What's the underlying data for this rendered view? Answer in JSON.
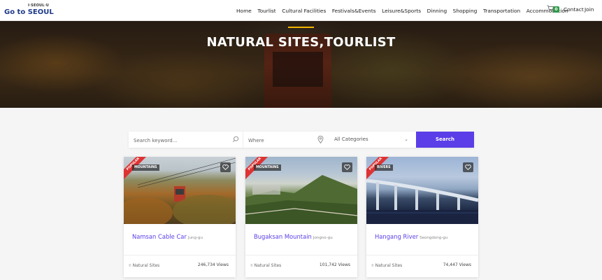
{
  "header": {
    "logo_tagline": "I·SEOUL·U",
    "logo_brand": "Go to SEOUL",
    "nav": [
      "Home",
      "Tourlist",
      "Cultural Facilities",
      "Festivals&Events",
      "Leisure&Sports",
      "Dinning",
      "Shopping",
      "Transportation",
      "Accommodation"
    ],
    "cart_count": "0",
    "contact_label": "Contact",
    "join_label": "Join"
  },
  "hero": {
    "title": "NATURAL SITES,TOURLIST"
  },
  "search": {
    "keyword_placeholder": "Search keyword...",
    "where_placeholder": "Where",
    "category_value": "All Categories",
    "button_label": "Search"
  },
  "cards": [
    {
      "badge": "POPULAR",
      "category": "MOUNTAINS",
      "title": "Namsan Cable Car",
      "district": "Jung-gu",
      "type": "Natural Sites",
      "views": "246,734 Views"
    },
    {
      "badge": "POPULAR",
      "category": "MOUNTAINS",
      "title": "Bugaksan Mountain",
      "district": "Jongno-gu",
      "type": "Natural Sites",
      "views": "101,742 Views"
    },
    {
      "badge": "POPULAR",
      "category": "RIVERS",
      "title": "Hangang River",
      "district": "Seongdong-gu",
      "type": "Natural Sites",
      "views": "74,447 Views"
    }
  ],
  "colors": {
    "accent": "#5b3ee8",
    "ribbon": "#dd3333",
    "cart_badge": "#2e9a48",
    "hero_bar": "#f2b400"
  }
}
